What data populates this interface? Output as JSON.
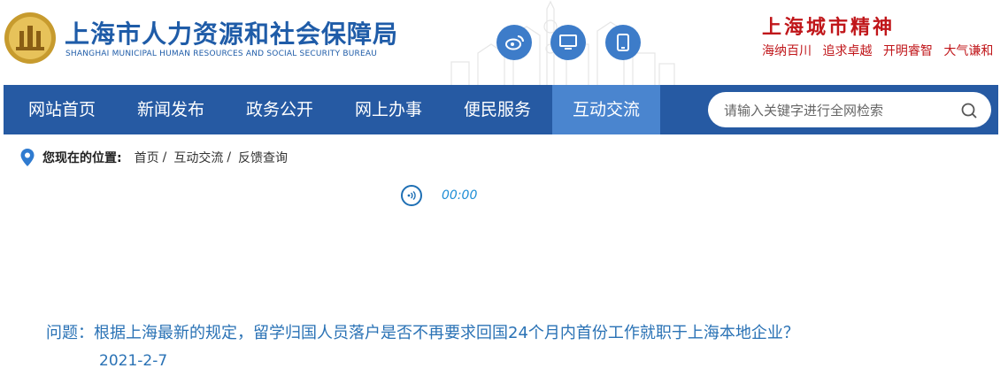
{
  "header": {
    "title": "上海市人力资源和社会保障局",
    "subtitle": "SHANGHAI MUNICIPAL HUMAN RESOURCES AND SOCIAL SECURITY BUREAU",
    "logo_icon": "bureau-emblem",
    "social_icons": [
      "weibo-icon",
      "desktop-icon",
      "mobile-icon"
    ],
    "spirit": {
      "title": "上海城市精神",
      "words": [
        "海纳百川",
        "追求卓越",
        "开明睿智",
        "大气谦和"
      ]
    }
  },
  "nav": {
    "items": [
      {
        "label": "网站首页"
      },
      {
        "label": "新闻发布"
      },
      {
        "label": "政务公开"
      },
      {
        "label": "网上办事"
      },
      {
        "label": "便民服务"
      },
      {
        "label": "互动交流",
        "active": true
      }
    ],
    "search": {
      "placeholder": "请输入关键字进行全网检索"
    }
  },
  "breadcrumb": {
    "label": "您现在的位置:",
    "items": [
      "首页",
      "互动交流",
      "反馈查询"
    ],
    "separator": "/"
  },
  "audio": {
    "time": "00:00"
  },
  "question": {
    "text": "问题：根据上海最新的规定，留学归国人员落户是否不再要求回国24个月内首份工作就职于上海本地企业？",
    "date": "2021-2-7"
  },
  "colors": {
    "brand_blue": "#265aa3",
    "active_tab": "#4a85cf",
    "spirit_red": "#c0161a",
    "question_blue": "#2a72b5"
  }
}
